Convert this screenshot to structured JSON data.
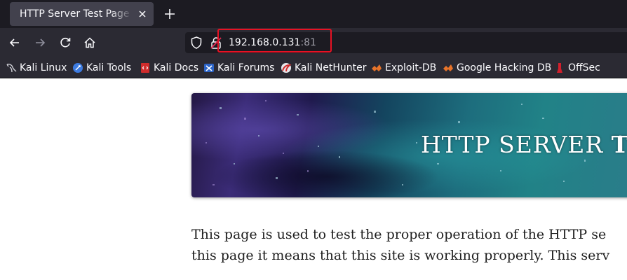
{
  "tab": {
    "title": "HTTP Server Test Page powered by"
  },
  "address_bar": {
    "host": "192.168.0.131",
    "port": ":81"
  },
  "bookmarks": [
    {
      "label": "Kali Linux",
      "icon": "kali-dragon-icon"
    },
    {
      "label": "Kali Tools",
      "icon": "kali-tools-icon"
    },
    {
      "label": "Kali Docs",
      "icon": "kali-docs-icon"
    },
    {
      "label": "Kali Forums",
      "icon": "kali-forums-icon"
    },
    {
      "label": "Kali NetHunter",
      "icon": "kali-nethunter-icon"
    },
    {
      "label": "Exploit-DB",
      "icon": "exploit-db-icon"
    },
    {
      "label": "Google Hacking DB",
      "icon": "google-hacking-db-icon"
    },
    {
      "label": "OffSec",
      "icon": "offsec-icon"
    }
  ],
  "page": {
    "banner_title_normal": "HTTP SERVER ",
    "banner_title_bold": "TE",
    "paragraph_line1": "This page is used to test the proper operation of the HTTP se",
    "paragraph_line2": "this page it means that this site is working properly. This serv"
  },
  "colors": {
    "chrome_dark": "#1c1b22",
    "toolbar": "#2b2a33",
    "active_tab": "#42414d",
    "highlight_box": "#e81123"
  }
}
